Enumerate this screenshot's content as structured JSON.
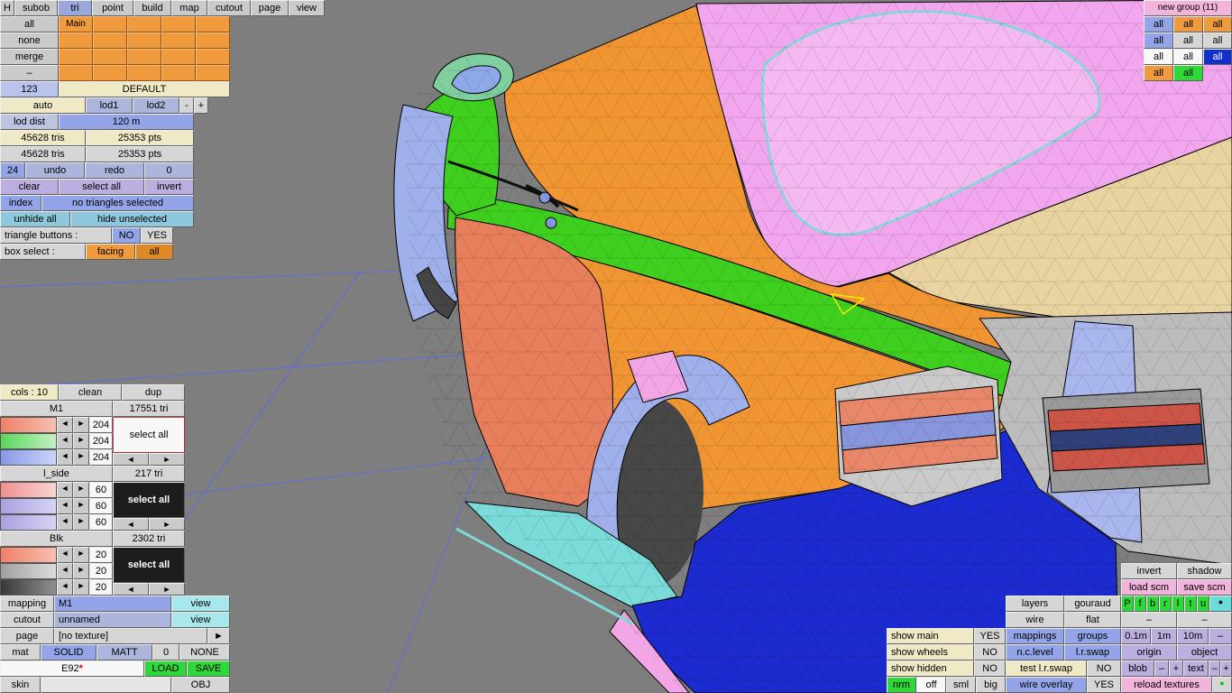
{
  "toolbar": {
    "items": [
      "H",
      "subob",
      "tri",
      "point",
      "build",
      "map",
      "cutout",
      "page",
      "view"
    ]
  },
  "groups_box": {
    "side_buttons": [
      "all",
      "none",
      "merge",
      "–",
      "123"
    ],
    "main_cell": "Main",
    "default_label": "DEFAULT"
  },
  "lod": {
    "auto": "auto",
    "lod1": "lod1",
    "lod2": "lod2",
    "minus": "-",
    "plus": "+",
    "dist_label": "lod dist",
    "dist_value": "120 m"
  },
  "stats": {
    "tris_a": "45628 tris",
    "pts_a": "25353 pts",
    "tris_b": "45628 tris",
    "pts_b": "25353 pts",
    "undo_count": "24",
    "undo_label": "undo",
    "redo_label": "redo",
    "redo_count": "0"
  },
  "selection": {
    "clear": "clear",
    "select_all": "select all",
    "invert": "invert",
    "index": "index",
    "status": "no triangles selected",
    "unhide_all": "unhide all",
    "hide_unselected": "hide unselected",
    "triangle_buttons_label": "triangle buttons :",
    "no": "NO",
    "yes": "YES",
    "box_select_label": "box select :",
    "facing": "facing",
    "all": "all"
  },
  "cols_panel": {
    "cols_label": "cols : 10",
    "clean": "clean",
    "dup": "dup",
    "arrow_left": "◄",
    "arrow_right": "►",
    "sections": [
      {
        "name": "M1",
        "tri": "17551 tri",
        "values": [
          "204",
          "204",
          "204"
        ],
        "select_all": "select all"
      },
      {
        "name": "l_side",
        "tri": "217 tri",
        "values": [
          "60",
          "60",
          "60"
        ],
        "select_all": "select all"
      },
      {
        "name": "Blk",
        "tri": "2302 tri",
        "values": [
          "20",
          "20",
          "20"
        ],
        "select_all": "select all"
      }
    ]
  },
  "mapping_panel": {
    "mapping_label": "mapping",
    "mapping_value": "M1",
    "mapping_view": "view",
    "cutout_label": "cutout",
    "cutout_value": "unnamed",
    "cutout_view": "view",
    "page_label": "page",
    "page_value": "[no texture]",
    "page_arrow": "►",
    "mat_label": "mat",
    "mat_solid": "SOLID",
    "mat_matt": "MATT",
    "mat_zero": "0",
    "mat_none": "NONE",
    "model_name": "E92",
    "modified_marker": "*",
    "load": "LOAD",
    "save": "SAVE",
    "skin_label": "skin",
    "obj_label": "OBJ"
  },
  "group_panel": {
    "title": "new group (11)",
    "rows": [
      [
        "all",
        "all",
        "all"
      ],
      [
        "all",
        "all",
        "all"
      ],
      [
        "all",
        "all",
        "all"
      ],
      [
        "all",
        "all"
      ]
    ]
  },
  "right_panel": {
    "invert": "invert",
    "shadow": "shadow",
    "load_scm": "load scm",
    "save_scm": "save scm",
    "layers": "layers",
    "gouraud": "gouraud",
    "wire": "wire",
    "flat": "flat",
    "dash_a": "–",
    "dash_b": "–",
    "proj_letters": [
      "P",
      "f",
      "b",
      "r",
      "l",
      "t",
      "u"
    ],
    "dot": "●",
    "show_main": "show main",
    "show_main_val": "YES",
    "mappings": "mappings",
    "groups": "groups",
    "scale_01": "0.1m",
    "scale_1": "1m",
    "scale_10": "10m",
    "scale_dash": "–",
    "show_wheels": "show wheels",
    "show_wheels_val": "NO",
    "nc_level": "n.c.level",
    "lr_swap": "l.r.swap",
    "origin": "origin",
    "object": "object",
    "show_hidden": "show hidden",
    "show_hidden_val": "NO",
    "test_lr_swap": "test l.r.swap",
    "test_lr_swap_val": "NO",
    "blob": "blob",
    "blob_minus": "–",
    "blob_plus": "+",
    "text": "text",
    "text_minus": "–",
    "text_plus": "+",
    "nrm": "nrm",
    "off": "off",
    "sml": "sml",
    "big": "big",
    "wire_overlay": "wire overlay",
    "wire_overlay_val": "YES",
    "reload_textures": "reload textures",
    "reload_dot": "●"
  },
  "colors": {
    "accent_green": "#2ed838",
    "accent_orange": "#ef9a3c",
    "accent_blue": "#93a5e8",
    "selected_blue": "#1030cc",
    "panel_pink": "#f2b4da",
    "grid_line": "#5b6fd6"
  }
}
